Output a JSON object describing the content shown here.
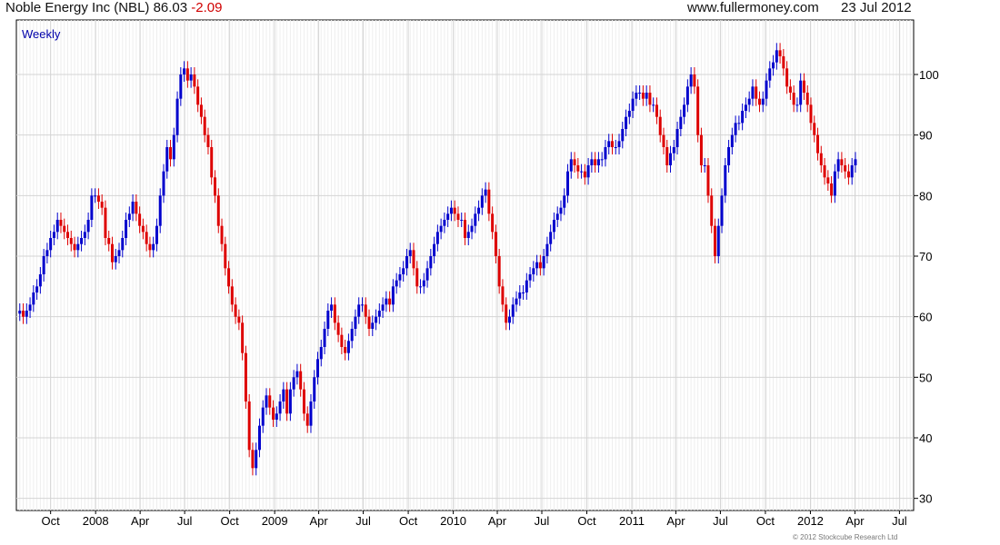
{
  "header": {
    "company": "Noble Energy Inc (NBL)",
    "price": "86.03",
    "change": "-2.09",
    "site": "www.fullermoney.com",
    "date": "23 Jul 2012"
  },
  "footer": {
    "copyright": "© 2012 Stockcube Research Ltd"
  },
  "colors": {
    "up": "#0000cc",
    "down": "#dd0000",
    "grid": "#d4d4d4",
    "axis": "#000000"
  },
  "chart_data": {
    "type": "candlestick",
    "frequency_label": "Weekly",
    "ylim": [
      28,
      109
    ],
    "yticks": [
      30,
      40,
      50,
      60,
      70,
      80,
      90,
      100
    ],
    "y_axis_side": "right",
    "grid": true,
    "xlim": [
      "2007-07-23",
      "2012-07-30"
    ],
    "xticks": [
      {
        "label": "Oct",
        "date": "2007-10-01"
      },
      {
        "label": "2008",
        "date": "2008-01-01"
      },
      {
        "label": "Apr",
        "date": "2008-04-01"
      },
      {
        "label": "Jul",
        "date": "2008-07-01"
      },
      {
        "label": "Oct",
        "date": "2008-10-01"
      },
      {
        "label": "2009",
        "date": "2009-01-01"
      },
      {
        "label": "Apr",
        "date": "2009-04-01"
      },
      {
        "label": "Jul",
        "date": "2009-07-01"
      },
      {
        "label": "Oct",
        "date": "2009-10-01"
      },
      {
        "label": "2010",
        "date": "2010-01-01"
      },
      {
        "label": "Apr",
        "date": "2010-04-01"
      },
      {
        "label": "Jul",
        "date": "2010-07-01"
      },
      {
        "label": "Oct",
        "date": "2010-10-01"
      },
      {
        "label": "2011",
        "date": "2011-01-01"
      },
      {
        "label": "Apr",
        "date": "2011-04-01"
      },
      {
        "label": "Jul",
        "date": "2011-07-01"
      },
      {
        "label": "Oct",
        "date": "2011-10-01"
      },
      {
        "label": "2012",
        "date": "2012-01-01"
      },
      {
        "label": "Apr",
        "date": "2012-04-01"
      },
      {
        "label": "Jul",
        "date": "2012-07-01"
      }
    ],
    "approx_weekly_closes": {
      "start": "2007-07-30",
      "step_days": 7,
      "values": [
        61,
        60,
        61,
        62,
        64,
        65,
        67,
        70,
        71,
        73,
        74,
        76,
        75,
        74,
        73,
        72,
        71,
        72,
        73,
        74,
        76,
        80,
        80,
        79,
        78,
        73,
        72,
        69,
        70,
        71,
        73,
        76,
        77,
        79,
        77,
        75,
        74,
        72,
        71,
        72,
        75,
        80,
        84,
        88,
        86,
        90,
        96,
        100,
        101,
        99,
        100,
        98,
        95,
        93,
        90,
        88,
        83,
        80,
        75,
        72,
        68,
        65,
        62,
        60,
        59,
        54,
        46,
        38,
        35,
        38,
        42,
        45,
        47,
        45,
        43,
        44,
        46,
        48,
        44,
        48,
        50,
        51,
        48,
        44,
        42,
        46,
        50,
        53,
        55,
        58,
        61,
        62,
        59,
        57,
        55,
        54,
        56,
        58,
        60,
        62,
        62,
        60,
        58,
        59,
        60,
        61,
        62,
        63,
        62,
        65,
        66,
        67,
        68,
        70,
        71,
        68,
        65,
        65,
        66,
        68,
        70,
        72,
        74,
        75,
        76,
        77,
        78,
        77,
        76,
        76,
        73,
        74,
        75,
        77,
        78,
        80,
        81,
        77,
        74,
        70,
        65,
        62,
        59,
        60,
        62,
        63,
        64,
        64,
        66,
        67,
        68,
        69,
        68,
        70,
        72,
        74,
        76,
        77,
        78,
        80,
        84,
        86,
        85,
        84,
        84,
        83,
        85,
        86,
        85,
        86,
        86,
        88,
        89,
        88,
        88,
        89,
        91,
        93,
        94,
        96,
        97,
        97,
        96,
        97,
        95,
        95,
        93,
        90,
        88,
        85,
        87,
        88,
        91,
        93,
        95,
        98,
        100,
        98,
        90,
        85,
        85,
        80,
        75,
        70,
        75,
        80,
        85,
        88,
        90,
        92,
        92,
        94,
        95,
        96,
        98,
        96,
        95,
        96,
        99,
        101,
        102,
        104,
        103,
        101,
        98,
        97,
        95,
        95,
        99,
        97,
        95,
        92,
        90,
        87,
        85,
        83,
        82,
        80,
        84,
        86,
        85,
        84,
        83,
        85,
        86
      ],
      "note_removed": true
    }
  }
}
